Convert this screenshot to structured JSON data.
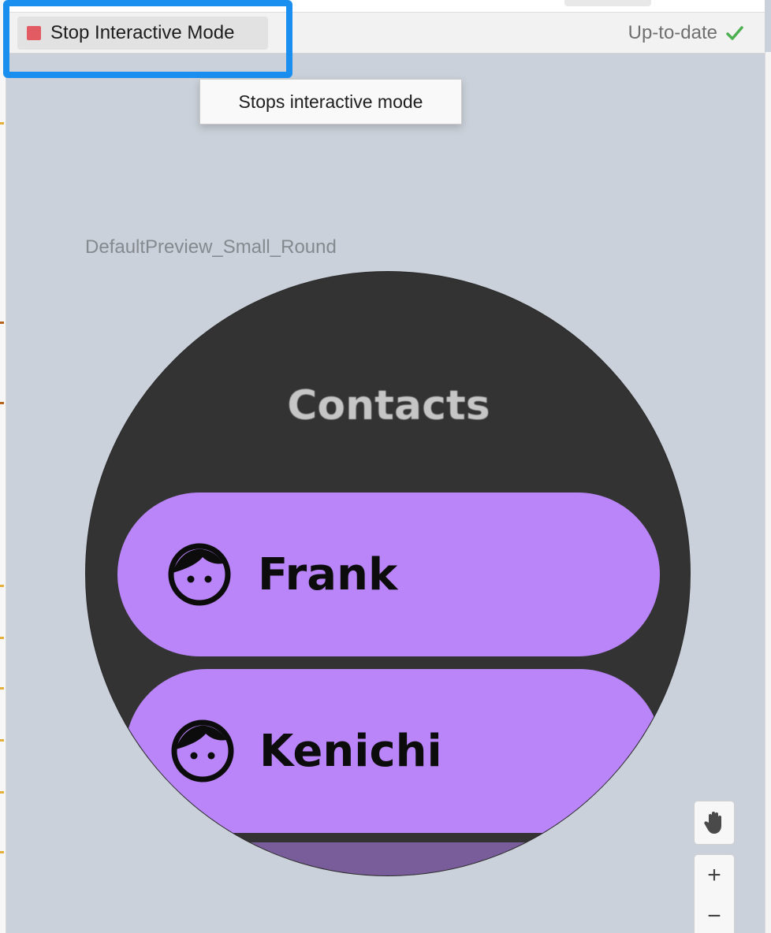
{
  "toolbar": {
    "stop_label": "Stop Interactive Mode",
    "status_label": "Up-to-date",
    "status_icon": "checkmark-icon",
    "stop_icon": "stop-square-icon",
    "stop_color": "#e25b63",
    "highlight_color": "#1b8ff0",
    "status_ok_color": "#4caf50"
  },
  "tooltip": {
    "text": "Stops interactive mode"
  },
  "preview": {
    "name": "DefaultPreview_Small_Round",
    "screen": {
      "title": "Contacts",
      "background": "#333333",
      "chip_color": "#b985f9",
      "contacts": [
        {
          "name": "Frank",
          "icon": "face-icon"
        },
        {
          "name": "Kenichi",
          "icon": "face-icon"
        }
      ]
    }
  },
  "controls": {
    "pan_icon": "hand-pan-icon",
    "zoom_in_label": "+",
    "zoom_out_label": "−"
  }
}
